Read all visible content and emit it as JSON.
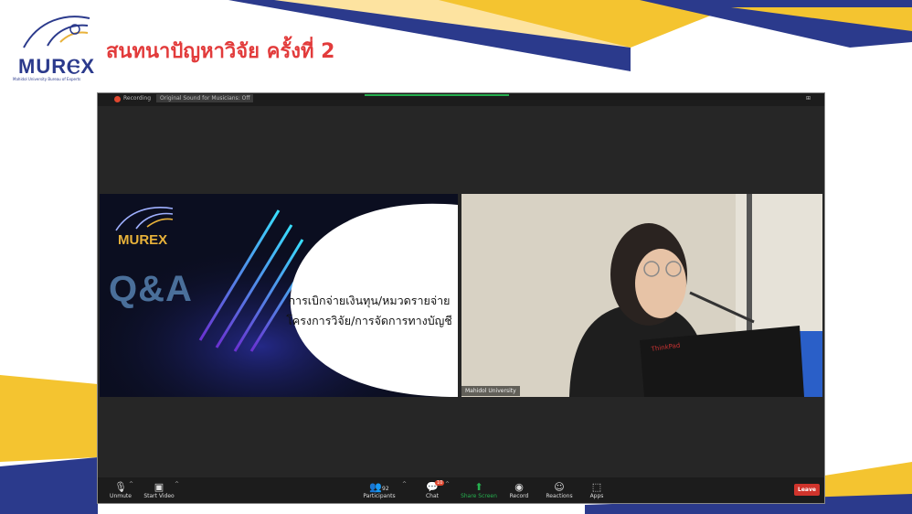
{
  "header": {
    "logo_text": "MURⲈX",
    "logo_sub": "Mahidol University Bureau of Experts",
    "title": "สนทนาปัญหาวิจัย ครั้งที่ 2"
  },
  "zoom": {
    "topbar": {
      "recording_label": "Recording",
      "sound_label": "Original Sound for Musicians: Off"
    },
    "slide": {
      "logo_text": "MUREX",
      "qa": "Q&A",
      "line1": "การเบิกจ่ายเงินทุน/หมวดรายจ่าย",
      "line2": "โครงการวิจัย/การจัดการทางบัญชี"
    },
    "participant": {
      "name": "Mahidol University"
    },
    "toolbar": {
      "unmute": "Unmute",
      "start_video": "Start Video",
      "participants": "Participants",
      "participants_count": "92",
      "chat": "Chat",
      "chat_badge": "10",
      "share_screen": "Share Screen",
      "record": "Record",
      "reactions": "Reactions",
      "apps": "Apps",
      "leave": "Leave"
    }
  },
  "colors": {
    "title_red": "#e23b3b",
    "navy": "#2b3a8c",
    "yellow": "#f4c430",
    "zoom_bg": "#262626",
    "leave_red": "#d0342c",
    "share_green": "#26b04f"
  }
}
